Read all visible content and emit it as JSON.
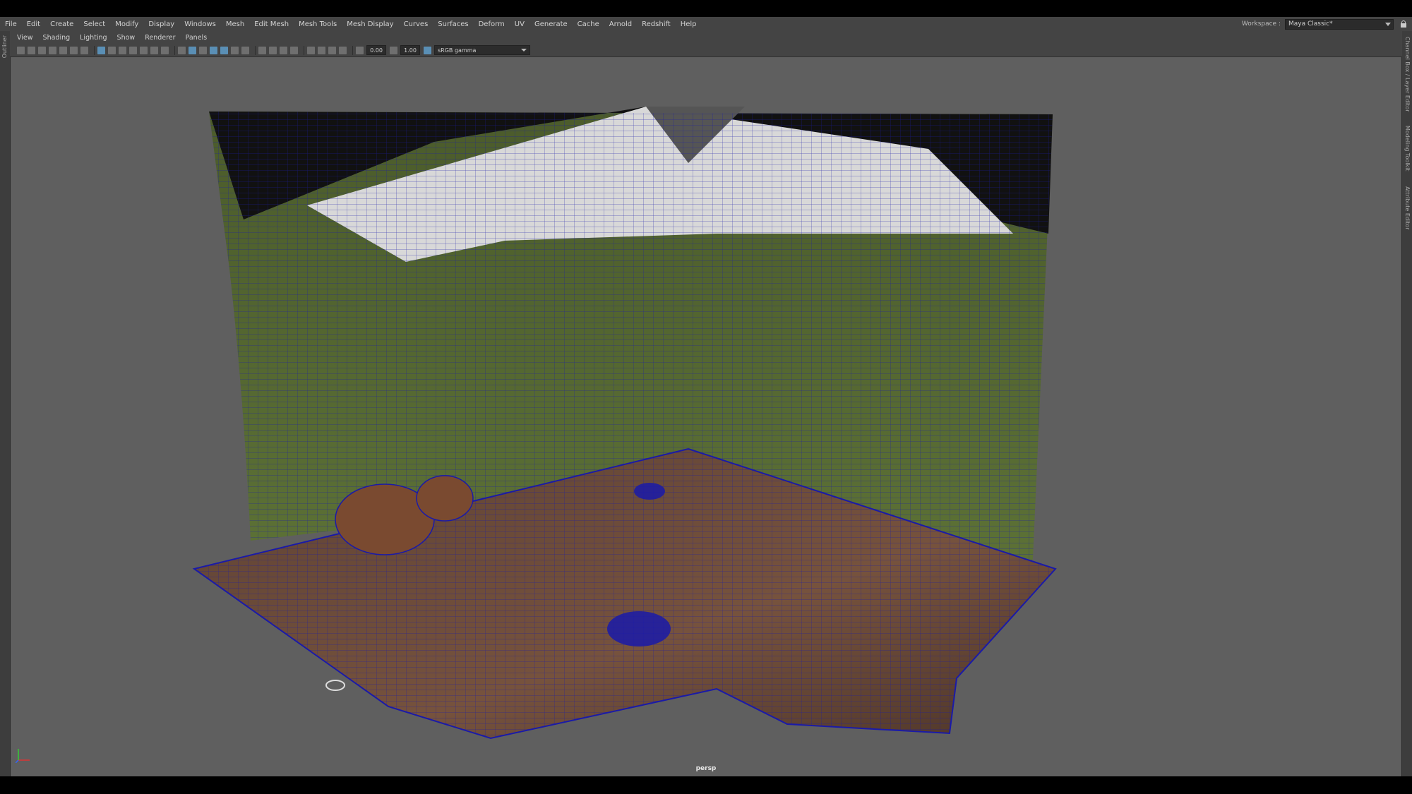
{
  "menu": [
    "File",
    "Edit",
    "Create",
    "Select",
    "Modify",
    "Display",
    "Windows",
    "Mesh",
    "Edit Mesh",
    "Mesh Tools",
    "Mesh Display",
    "Curves",
    "Surfaces",
    "Deform",
    "UV",
    "Generate",
    "Cache",
    "Arnold",
    "Redshift",
    "Help"
  ],
  "workspace": {
    "label": "Workspace :",
    "value": "Maya Classic*"
  },
  "left_tabs": [
    "Outliner"
  ],
  "right_tabs": [
    "Channel Box / Layer Editor",
    "Modeling Toolkit",
    "Attribute Editor"
  ],
  "panel_menu": [
    "View",
    "Shading",
    "Lighting",
    "Show",
    "Renderer",
    "Panels"
  ],
  "toolbar": {
    "exposure": "0.00",
    "gamma": "1.00",
    "color_space": "sRGB gamma"
  },
  "viewport": {
    "camera": "persp",
    "background": "#5f5f5f",
    "wire_color": "#1a1aa8",
    "wall_color": "#56692f",
    "floor_color": "#6a4a3a"
  }
}
